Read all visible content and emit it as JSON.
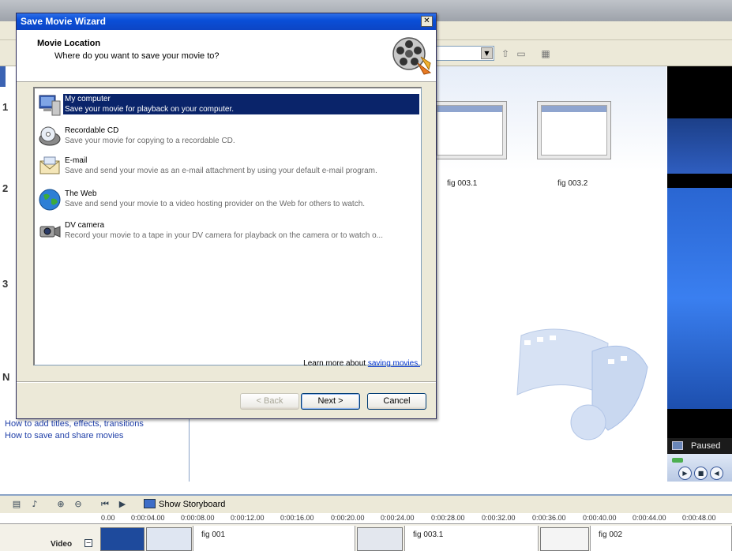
{
  "wizard": {
    "title": "Save Movie Wizard",
    "close_glyph": "✕",
    "header_title": "Movie Location",
    "header_subtitle": "Where do you want to save your movie to?",
    "options": [
      {
        "title": "My computer",
        "description": "Save your movie for playback on your computer.",
        "icon": "computer-icon",
        "selected": true
      },
      {
        "title": "Recordable CD",
        "description": "Save your movie for copying to a recordable CD.",
        "icon": "cd-icon",
        "selected": false
      },
      {
        "title": "E-mail",
        "description": "Save and send your movie as an e-mail attachment by using your default e-mail program.",
        "icon": "email-icon",
        "selected": false
      },
      {
        "title": "The Web",
        "description": "Save and send your movie to a video hosting provider on the Web for others to watch.",
        "icon": "globe-icon",
        "selected": false
      },
      {
        "title": "DV camera",
        "description": "Record your movie to a tape in your DV camera for playback on the camera or to watch o...",
        "icon": "camera-icon",
        "selected": false
      }
    ],
    "learn_more_prefix": "Learn more about ",
    "learn_more_link": "saving movies.",
    "buttons": {
      "back": "< Back",
      "next": "Next >",
      "cancel": "Cancel"
    }
  },
  "background": {
    "task_numbers": [
      "1",
      "2",
      "3",
      "N"
    ],
    "task_links": [
      "How to add titles, effects, transitions",
      "How to save and share movies"
    ],
    "collection_thumbs": [
      {
        "label": "fig 003.1"
      },
      {
        "label": "fig 003.2"
      }
    ],
    "preview_status": "Paused",
    "storyboard_toggle_label": "Show Storyboard",
    "timeline_ticks": [
      "0.00",
      "0:00:04.00",
      "0:00:08.00",
      "0:00:12.00",
      "0:00:16.00",
      "0:00:20.00",
      "0:00:24.00",
      "0:00:28.00",
      "0:00:32.00",
      "0:00:36.00",
      "0:00:40.00",
      "0:00:44.00",
      "0:00:48.00"
    ],
    "track_label": "Video",
    "clips": [
      {
        "label": "fig 001"
      },
      {
        "label": "fig 003.1"
      },
      {
        "label": "fig 002"
      }
    ]
  },
  "colors": {
    "title_bar": "#0a4fd8",
    "selection": "#0a246a",
    "link": "#0033cc"
  }
}
